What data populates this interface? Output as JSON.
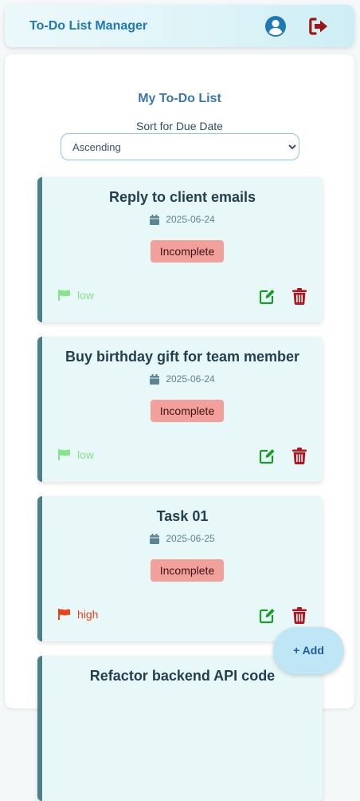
{
  "app": {
    "title": "To-Do List Manager"
  },
  "header": {
    "profile_icon": "user-circle-icon",
    "logout_icon": "sign-out-icon"
  },
  "main": {
    "title": "My To-Do List",
    "sort_label": "Sort for Due Date",
    "sort_selected": "Ascending"
  },
  "colors": {
    "brand": "#1e78b8",
    "low_priority": "#86e48a",
    "high_priority": "#e8431a",
    "incomplete_badge": "#f3a09c",
    "edit_icon": "#1a9a2a",
    "delete_icon": "#b8141d",
    "logout_icon": "#a01414"
  },
  "tasks": [
    {
      "title": "Reply to client emails",
      "date": "2025-06-24",
      "status": "Incomplete",
      "priority": "low"
    },
    {
      "title": "Buy birthday gift for team member",
      "date": "2025-06-24",
      "status": "Incomplete",
      "priority": "low"
    },
    {
      "title": "Task 01",
      "date": "2025-06-25",
      "status": "Incomplete",
      "priority": "high"
    },
    {
      "title": "Refactor backend API code"
    }
  ],
  "add_button": {
    "label": "+ Add"
  }
}
